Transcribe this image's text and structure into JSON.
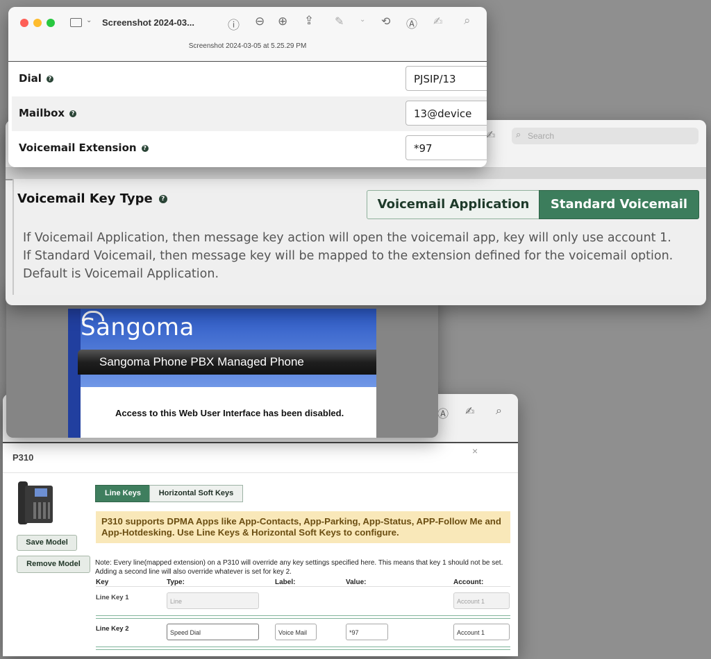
{
  "window_top": {
    "title": "Screenshot 2024-03...",
    "subtitle": "Screenshot 2024-03-05 at 5.25.29 PM",
    "fields": [
      {
        "label": "Dial",
        "value": "PJSIP/13"
      },
      {
        "label": "Mailbox",
        "value": "13@device"
      },
      {
        "label": "Voicemail Extension",
        "value": "*97"
      }
    ]
  },
  "window_voicemail": {
    "search_placeholder": "Search",
    "heading": "Voicemail Key Type",
    "options": [
      "Voicemail Application",
      "Standard Voicemail"
    ],
    "selected_option": "Standard Voicemail",
    "description": [
      "If Voicemail Application, then message key action will open the voicemail app, key will only use account 1.",
      "If Standard Voicemail, then message key will be mapped to the extension defined for the voicemail option.",
      "Default is Voicemail Application."
    ]
  },
  "window_sangoma": {
    "logo": "Sangoma",
    "banner": "Sangoma Phone PBX Managed Phone",
    "message": "Access to this Web User Interface has been disabled."
  },
  "window_p310": {
    "title": "P310",
    "close": "×",
    "buttons": {
      "save": "Save Model",
      "remove": "Remove Model"
    },
    "tabs": [
      "Line Keys",
      "Horizontal Soft Keys"
    ],
    "active_tab": "Line Keys",
    "notice": "P310 supports DPMA Apps like App-Contacts, App-Parking, App-Status, APP-Follow Me and App-Hotdesking. Use Line Keys & Horizontal Soft Keys to configure.",
    "note": "Note: Every line(mapped extension) on a P310 will override any key settings specified here. This means that key 1 should not be set. Adding a second line will also override whatever is set for key 2.",
    "headers": {
      "key": "Key",
      "type": "Type:",
      "label": "Label:",
      "value": "Value:",
      "account": "Account:"
    },
    "rows": [
      {
        "key": "Line Key 1",
        "type": "Line",
        "label": "",
        "value": "",
        "account": "Account 1"
      },
      {
        "key": "Line Key 2",
        "type": "Speed Dial",
        "label": "Voice Mail",
        "value": "*97",
        "account": "Account 1"
      }
    ]
  },
  "colors": {
    "accent": "#3c7d5c",
    "notice_bg": "#f9e8b9",
    "notice_text": "#6b4e12"
  }
}
